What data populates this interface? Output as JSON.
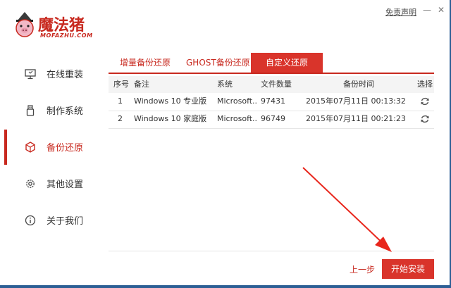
{
  "header": {
    "brand": "魔法猪",
    "brand_sub": "MOFAZHU.COM",
    "disclaimer": "免责声明",
    "minimize_glyph": "—",
    "close_glyph": "✕"
  },
  "sidebar": {
    "items": [
      {
        "label": "在线重装",
        "icon": "monitor-icon",
        "active": false
      },
      {
        "label": "制作系统",
        "icon": "usb-icon",
        "active": false
      },
      {
        "label": "备份还原",
        "icon": "cube-icon",
        "active": true
      },
      {
        "label": "其他设置",
        "icon": "gear-icon",
        "active": false
      },
      {
        "label": "关于我们",
        "icon": "info-icon",
        "active": false
      }
    ]
  },
  "tabs": [
    {
      "label": "增量备份还原",
      "active": false
    },
    {
      "label": "GHOST备份还原",
      "active": false
    },
    {
      "label": "自定义还原",
      "active": true
    }
  ],
  "table": {
    "headers": [
      "序号",
      "备注",
      "系统",
      "文件数量",
      "备份时间",
      "选择"
    ],
    "rows": [
      {
        "index": "1",
        "note": "Windows 10 专业版",
        "system": "Microsoft...",
        "files": "97431",
        "time": "2015年07月11日 00:13:32"
      },
      {
        "index": "2",
        "note": "Windows 10 家庭版",
        "system": "Microsoft...",
        "files": "96749",
        "time": "2015年07月11日 00:21:23"
      }
    ]
  },
  "footer": {
    "prev_label": "上一步",
    "start_label": "开始安装"
  },
  "colors": {
    "accent": "#d9342b",
    "accent_text": "#c8291f",
    "window_border": "#2d5f95"
  }
}
